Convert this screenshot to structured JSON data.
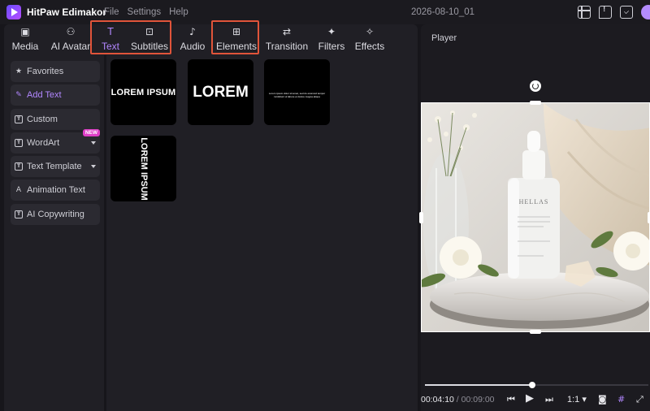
{
  "app": {
    "name": "HitPaw Edimakor",
    "menu": [
      "File",
      "Settings",
      "Help"
    ],
    "project_title": "2026-08-10_01"
  },
  "toolbar": {
    "tabs": [
      {
        "label": "Media",
        "icon": "media-icon"
      },
      {
        "label": "AI Avatar",
        "icon": "ai-avatar-icon"
      },
      {
        "label": "Text",
        "icon": "text-icon",
        "active": true
      },
      {
        "label": "Subtitles",
        "icon": "subtitles-icon"
      },
      {
        "label": "Audio",
        "icon": "audio-icon"
      },
      {
        "label": "Elements",
        "icon": "elements-icon"
      },
      {
        "label": "Transition",
        "icon": "transition-icon"
      },
      {
        "label": "Filters",
        "icon": "filters-icon"
      },
      {
        "label": "Effects",
        "icon": "effects-icon"
      }
    ]
  },
  "sidebar": {
    "items": [
      {
        "label": "Favorites",
        "icon": "star-icon"
      },
      {
        "label": "Add Text",
        "icon": "add-text-icon",
        "active": true
      },
      {
        "label": "Custom",
        "icon": "custom-text-icon"
      },
      {
        "label": "WordArt",
        "icon": "wordart-icon",
        "badge": "NEW",
        "expandable": true
      },
      {
        "label": "Text Template",
        "icon": "text-template-icon",
        "expandable": true
      },
      {
        "label": "Animation Text",
        "icon": "animation-text-icon"
      },
      {
        "label": "AI Copywriting",
        "icon": "ai-copywriting-icon"
      }
    ]
  },
  "text_presets": [
    {
      "text": "LOREM IPSUM"
    },
    {
      "text": "LOREM"
    },
    {
      "text": "Lorem ipsum dolor sit amet, sed do eiusmod tempor incididunt ut labore et dolore magna aliqua"
    },
    {
      "text": "LOREM IPSUM"
    }
  ],
  "player": {
    "title": "Player",
    "current_time": "00:04:10",
    "separator": "/",
    "total_time": "00:09:00",
    "progress": 0.48,
    "ratio": "1:1",
    "product_label": "HELLAS"
  },
  "colors": {
    "accent": "#b287ff",
    "highlight_box": "#e0543a",
    "badge_new": "#e040c8"
  }
}
